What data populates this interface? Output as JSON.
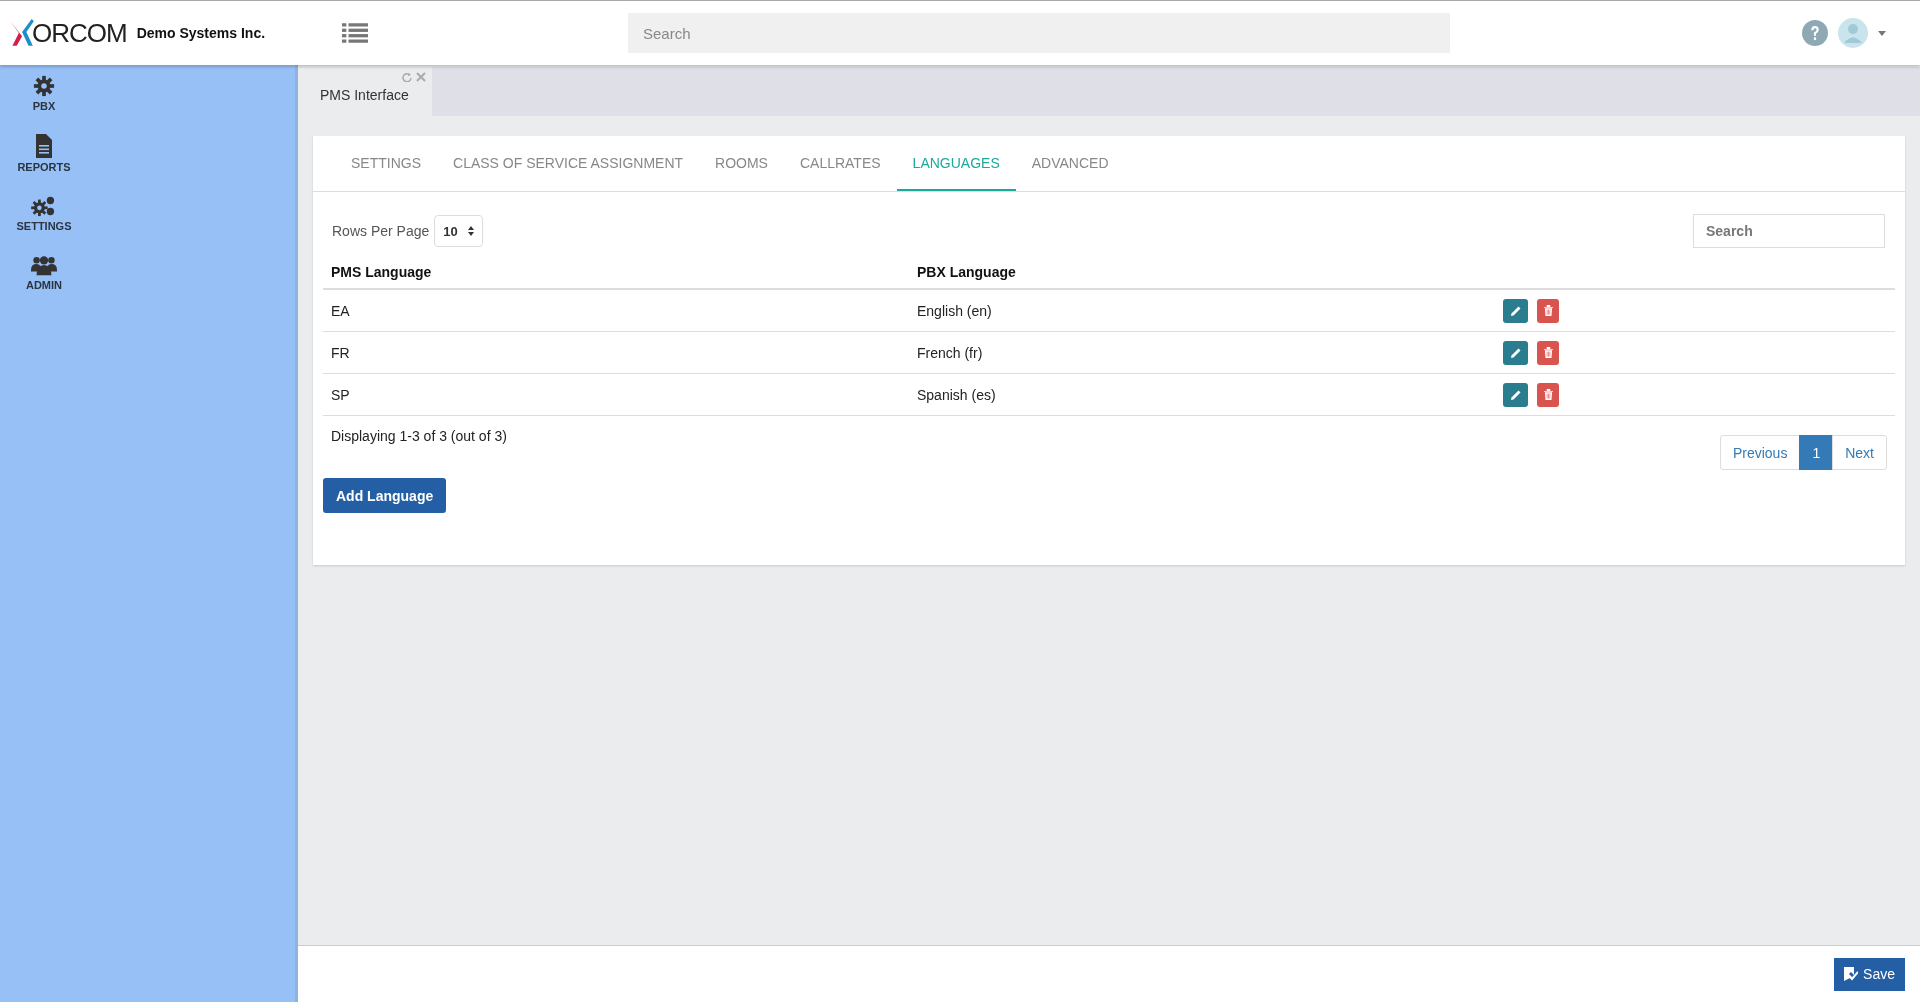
{
  "header": {
    "logo": "ORCOM",
    "company": "Demo Systems Inc.",
    "search": {
      "placeholder": "Search"
    }
  },
  "sidebar": {
    "items": [
      {
        "label": "PBX",
        "kind": "gear"
      },
      {
        "label": "REPORTS",
        "kind": "file"
      },
      {
        "label": "SETTINGS",
        "kind": "gears"
      },
      {
        "label": "ADMIN",
        "kind": "users"
      }
    ]
  },
  "doc_tabs": [
    {
      "label": "PMS Interface",
      "selected": true
    }
  ],
  "tabs": [
    {
      "label": "SETTINGS",
      "selected": false
    },
    {
      "label": "CLASS OF SERVICE ASSIGNMENT",
      "selected": false
    },
    {
      "label": "ROOMS",
      "selected": false
    },
    {
      "label": "CALLRATES",
      "selected": false
    },
    {
      "label": "LANGUAGES",
      "selected": true
    },
    {
      "label": "ADVANCED",
      "selected": false
    }
  ],
  "rows_per_page": {
    "label": "Rows Per Page",
    "value": "10"
  },
  "table_search": {
    "placeholder": "Search"
  },
  "table": {
    "columns": [
      "PMS Language",
      "PBX Language"
    ],
    "rows": [
      [
        "EA",
        "English (en)"
      ],
      [
        "FR",
        "French (fr)"
      ],
      [
        "SP",
        "Spanish (es)"
      ]
    ]
  },
  "summary": "Displaying 1-3 of 3 (out of 3)",
  "pagination": [
    {
      "label": "Previous",
      "selected": false
    },
    {
      "label": "1",
      "selected": true
    },
    {
      "label": "Next",
      "selected": false
    }
  ],
  "add_button": "Add Language",
  "save_button": "Save"
}
